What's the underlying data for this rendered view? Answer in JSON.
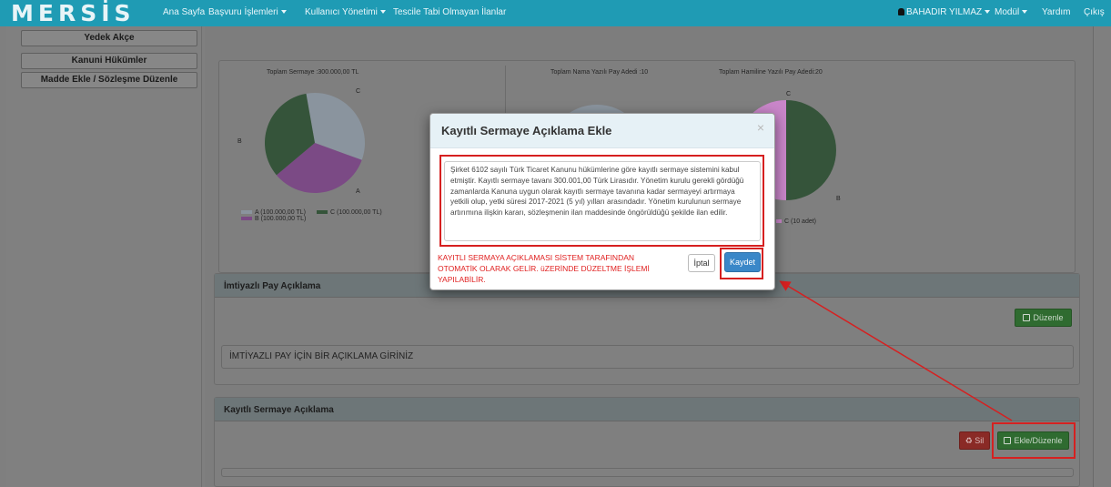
{
  "navbar": {
    "logo": "MERSİS",
    "items": [
      {
        "label": "Ana Sayfa",
        "dropdown": false
      },
      {
        "label": "Başvuru İşlemleri",
        "dropdown": true
      },
      {
        "label": "Kullanıcı Yönetimi",
        "dropdown": true
      },
      {
        "label": "Tescile Tabi Olmayan İlanlar",
        "dropdown": false
      }
    ],
    "user": "BAHADIR YILMAZ",
    "modul": "Modül",
    "help": "Yardım",
    "logout": "Çıkış"
  },
  "sidebar": {
    "items": [
      {
        "label": "Yedek Akçe"
      },
      {
        "label": "Kanuni Hükümler"
      },
      {
        "label": "Madde Ekle / Sözleşme Düzenle"
      }
    ]
  },
  "charts": {
    "left_title": "Toplam Sermaye :300.000,00 TL",
    "mid_title": "Toplam Nama Yazılı Pay Adedi :10",
    "right_title": "Toplam Hamiline Yazılı Pay Adedi:20"
  },
  "chart_data": [
    {
      "type": "pie",
      "title": "Toplam Sermaye :300.000,00 TL",
      "labels": [
        "A",
        "B",
        "C"
      ],
      "values": [
        100000,
        100000,
        100000
      ],
      "legend": [
        "A (100.000,00 TL)",
        "B (100.000,00 TL)",
        "C (100.000,00 TL)"
      ],
      "colors": [
        "#8a949e",
        "#7b4a85",
        "#35543a"
      ]
    },
    {
      "type": "pie",
      "title": "Toplam Nama Yazılı Pay Adedi :10",
      "values": [
        10
      ],
      "colors": [
        "#8a949e"
      ]
    },
    {
      "type": "pie",
      "title": "Toplam Hamiline Yazılı Pay Adedi:20",
      "labels": [
        "B",
        "C"
      ],
      "values": [
        10,
        10
      ],
      "legend": [
        "C (10 adet)"
      ],
      "colors": [
        "#35543a",
        "#c986c9"
      ]
    }
  ],
  "imtiyazli": {
    "title": "İmtiyazlı Pay Açıklama",
    "edit_label": "Düzenle",
    "text": "İMTİYAZLI PAY İÇİN BİR AÇIKLAMA GİRİNİZ"
  },
  "kayitli": {
    "title": "Kayıtlı Sermaye Açıklama",
    "delete_label": "Sil",
    "edit_label": "Ekle/Düzenle"
  },
  "modal": {
    "title": "Kayıtlı Sermaye Açıklama Ekle",
    "close": "×",
    "description": "Şirket 6102 sayılı Türk Ticaret Kanunu hükümlerine göre kayıtlı sermaye sistemini kabul etmiştir. Kayıtlı sermaye tavanı 300.001,00 Türk Lirasıdır. Yönetim kurulu gerekli gördüğü zamanlarda Kanuna uygun olarak kayıtlı sermaye tavanına kadar sermayeyi artırmaya yetkili olup, yetki süresi 2017-2021 (5 yıl) yılları arasındadır. Yönetim kurulunun sermaye artırımına ilişkin kararı, sözleşmenin ilan maddesinde öngörüldüğü şekilde ilan edilir.",
    "warning": "KAYITLI SERMAYA AÇIKLAMASI SİSTEM TARAFINDAN OTOMATİK OLARAK GELİR. üZERİNDE DÜZELTME İŞLEMİ YAPILABİLİR.",
    "cancel": "İptal",
    "save": "Kaydet"
  },
  "colors": {
    "navbar": "#1f9bb4",
    "annotation": "#d62020",
    "save_button": "#3a87c8",
    "edit_button": "#2f6b30",
    "delete_button": "#8a2a26"
  }
}
